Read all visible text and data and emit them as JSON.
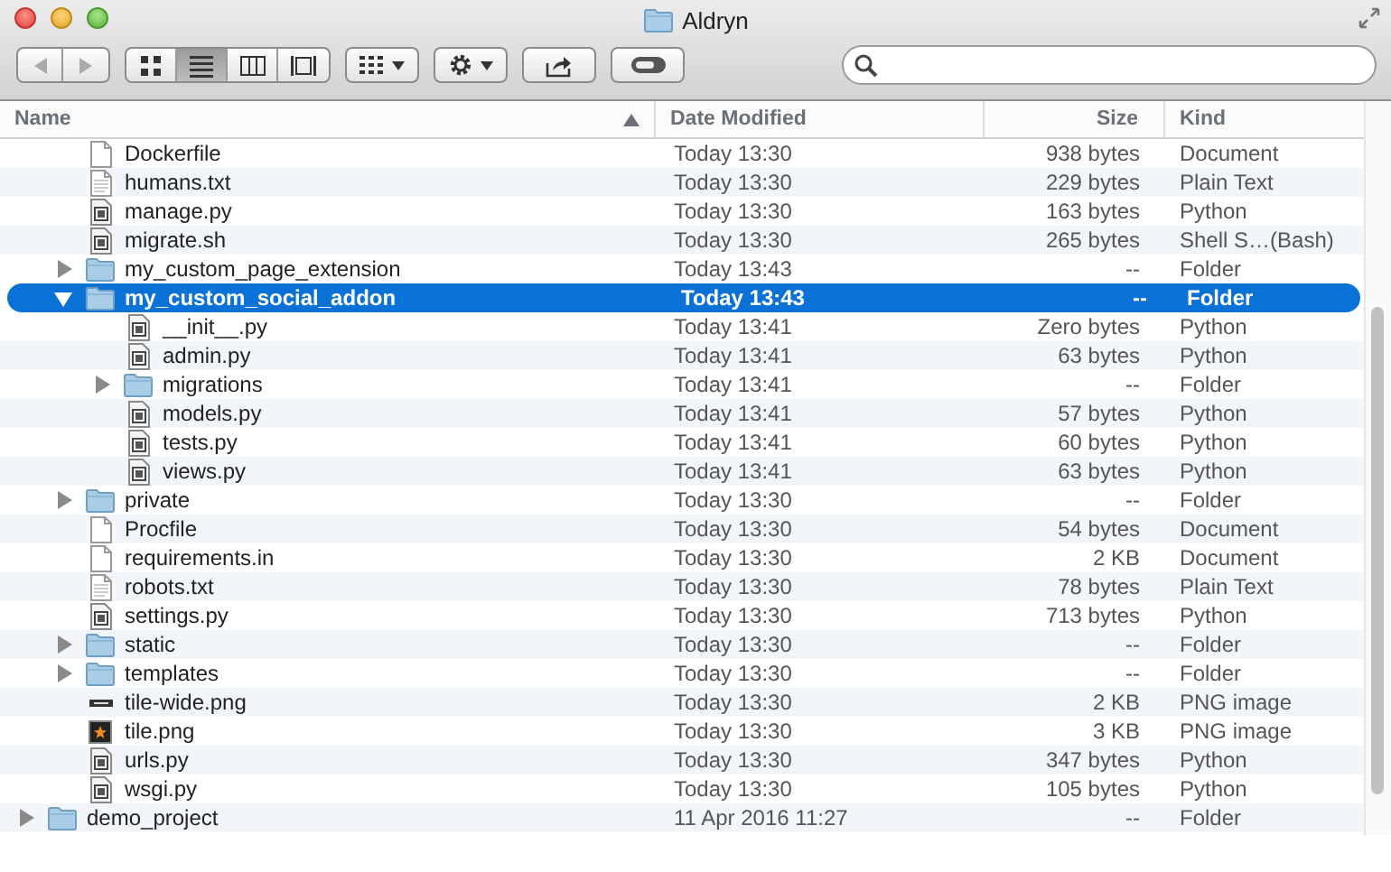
{
  "window": {
    "title": "Aldryn"
  },
  "toolbar": {
    "view_modes": [
      {
        "selected": false
      },
      {
        "selected": true
      },
      {
        "selected": false
      },
      {
        "selected": false
      }
    ]
  },
  "columns": [
    {
      "label": "Name",
      "sorted": true
    },
    {
      "label": "Date Modified",
      "sorted": false
    },
    {
      "label": "Size",
      "sorted": false
    },
    {
      "label": "Kind",
      "sorted": false
    }
  ],
  "tree": {
    "items": [
      {
        "name": "Dockerfile",
        "date": "Today 13:30",
        "size": "938 bytes",
        "file_kind": "Document",
        "kind": "document",
        "selected": false
      },
      {
        "name": "humans.txt",
        "date": "Today 13:30",
        "size": "229 bytes",
        "file_kind": "Plain Text",
        "kind": "text",
        "selected": false
      },
      {
        "name": "manage.py",
        "date": "Today 13:30",
        "size": "163 bytes",
        "file_kind": "Python",
        "kind": "script",
        "selected": false
      },
      {
        "name": "migrate.sh",
        "date": "Today 13:30",
        "size": "265 bytes",
        "file_kind": "Shell S…(Bash)",
        "kind": "script",
        "selected": false
      },
      {
        "name": "my_custom_page_extension",
        "date": "Today 13:43",
        "size": "--",
        "file_kind": "Folder",
        "kind": "folder",
        "expanded": false,
        "selected": false
      },
      {
        "name": "my_custom_social_addon",
        "date": "Today 13:43",
        "size": "--",
        "file_kind": "Folder",
        "kind": "folder",
        "expanded": true,
        "selected": true,
        "children": [
          {
            "name": "__init__.py",
            "date": "Today 13:41",
            "size": "Zero bytes",
            "file_kind": "Python",
            "kind": "script",
            "selected": false
          },
          {
            "name": "admin.py",
            "date": "Today 13:41",
            "size": "63 bytes",
            "file_kind": "Python",
            "kind": "script",
            "selected": false
          },
          {
            "name": "migrations",
            "date": "Today 13:41",
            "size": "--",
            "file_kind": "Folder",
            "kind": "folder",
            "expanded": false,
            "selected": false
          },
          {
            "name": "models.py",
            "date": "Today 13:41",
            "size": "57 bytes",
            "file_kind": "Python",
            "kind": "script",
            "selected": false
          },
          {
            "name": "tests.py",
            "date": "Today 13:41",
            "size": "60 bytes",
            "file_kind": "Python",
            "kind": "script",
            "selected": false
          },
          {
            "name": "views.py",
            "date": "Today 13:41",
            "size": "63 bytes",
            "file_kind": "Python",
            "kind": "script",
            "selected": false
          }
        ]
      },
      {
        "name": "private",
        "date": "Today 13:30",
        "size": "--",
        "file_kind": "Folder",
        "kind": "folder",
        "expanded": false,
        "selected": false
      },
      {
        "name": "Procfile",
        "date": "Today 13:30",
        "size": "54 bytes",
        "file_kind": "Document",
        "kind": "document",
        "selected": false
      },
      {
        "name": "requirements.in",
        "date": "Today 13:30",
        "size": "2 KB",
        "file_kind": "Document",
        "kind": "document",
        "selected": false
      },
      {
        "name": "robots.txt",
        "date": "Today 13:30",
        "size": "78 bytes",
        "file_kind": "Plain Text",
        "kind": "text",
        "selected": false
      },
      {
        "name": "settings.py",
        "date": "Today 13:30",
        "size": "713 bytes",
        "file_kind": "Python",
        "kind": "script",
        "selected": false
      },
      {
        "name": "static",
        "date": "Today 13:30",
        "size": "--",
        "file_kind": "Folder",
        "kind": "folder",
        "expanded": false,
        "selected": false
      },
      {
        "name": "templates",
        "date": "Today 13:30",
        "size": "--",
        "file_kind": "Folder",
        "kind": "folder",
        "expanded": false,
        "selected": false
      },
      {
        "name": "tile-wide.png",
        "date": "Today 13:30",
        "size": "2 KB",
        "file_kind": "PNG image",
        "kind": "wide-image",
        "selected": false
      },
      {
        "name": "tile.png",
        "date": "Today 13:30",
        "size": "3 KB",
        "file_kind": "PNG image",
        "kind": "image",
        "selected": false
      },
      {
        "name": "urls.py",
        "date": "Today 13:30",
        "size": "347 bytes",
        "file_kind": "Python",
        "kind": "script",
        "selected": false
      },
      {
        "name": "wsgi.py",
        "date": "Today 13:30",
        "size": "105 bytes",
        "file_kind": "Python",
        "kind": "script",
        "selected": false
      }
    ],
    "after": [
      {
        "name": "demo_project",
        "date": "11 Apr 2016 11:27",
        "size": "--",
        "file_kind": "Folder",
        "kind": "folder",
        "expanded": false,
        "selected": false
      }
    ]
  }
}
